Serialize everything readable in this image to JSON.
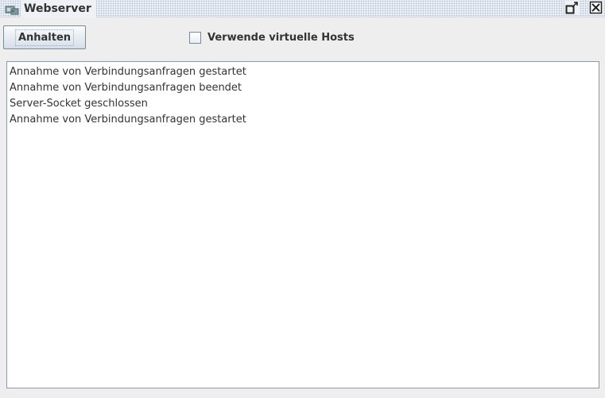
{
  "window": {
    "title": "Webserver",
    "icon": "server-icon",
    "controls": [
      "restore-icon",
      "close-icon"
    ]
  },
  "toolbar": {
    "stop_label": "Anhalten",
    "virtual_hosts_label": "Verwende virtuelle Hosts",
    "virtual_hosts_checked": false
  },
  "log": {
    "lines": [
      "Annahme von Verbindungsanfragen gestartet",
      "Annahme von Verbindungsanfragen beendet",
      "Server-Socket geschlossen",
      "Annahme von Verbindungsanfragen gestartet"
    ]
  },
  "colors": {
    "background": "#eeeeee",
    "titlebar": "#eef1f5",
    "text": "#333333",
    "border": "#8c9aa8"
  }
}
